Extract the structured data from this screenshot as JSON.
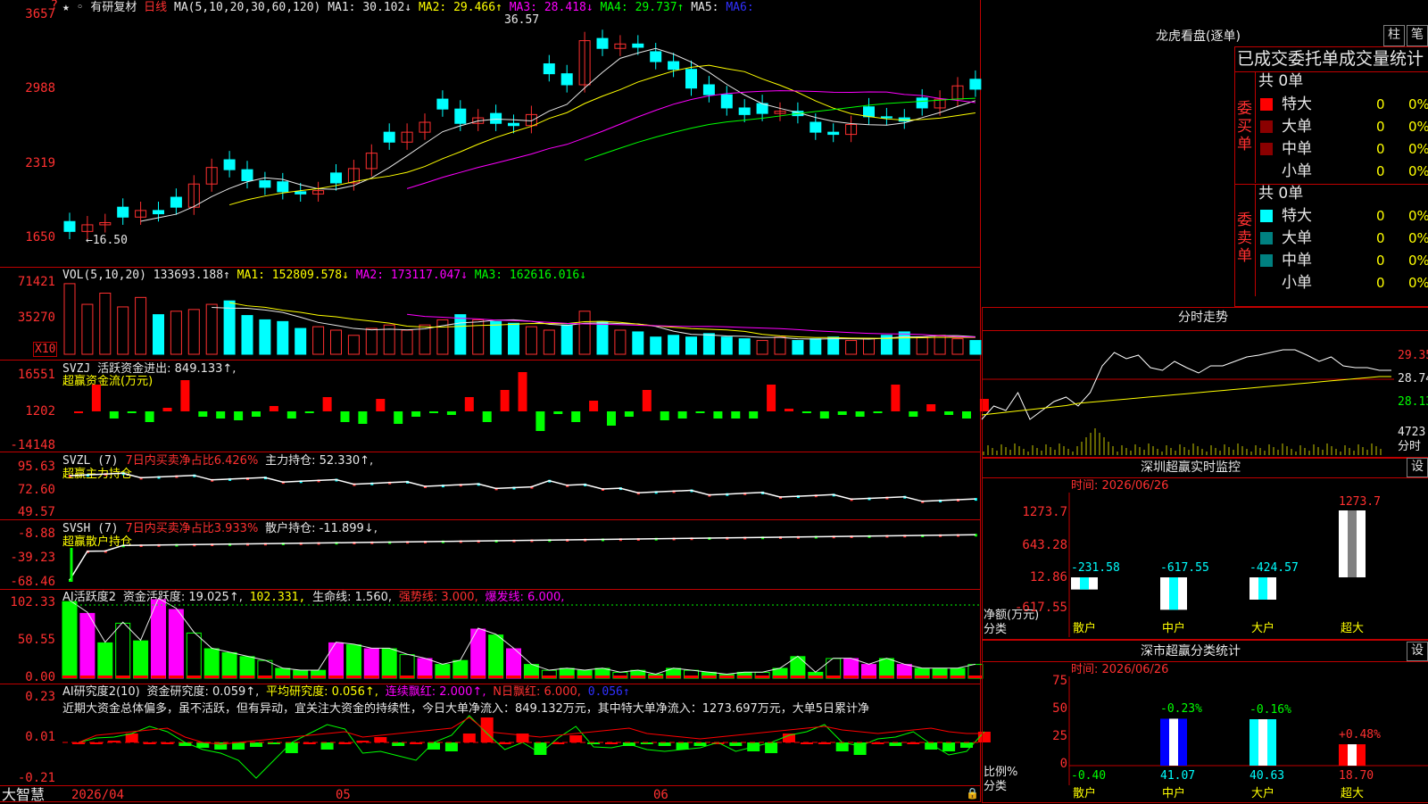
{
  "chart_header": {
    "title": "有研复材",
    "period": "日线",
    "ma_label": "MA(5,10,20,30,60,120)",
    "ma1": "MA1: 30.102↓",
    "ma2": "MA2: 29.466↑",
    "ma3": "MA3: 28.418↓",
    "ma4": "MA4: 29.737↑",
    "ma5": "MA5:",
    "ma6": "MA6:",
    "high_mark": "36.57",
    "low_mark": "←16.50"
  },
  "price_axis": [
    "3657",
    "2988",
    "2319",
    "1650"
  ],
  "vol_header": {
    "label": "VOL(5,10,20)",
    "value": "133693.188↑",
    "ma1": "MA1: 152809.578↓",
    "ma2": "MA2: 173117.047↓",
    "ma3": "MA3: 162616.016↓",
    "unit": "X10"
  },
  "vol_axis": [
    "71421",
    "35270"
  ],
  "svzj": {
    "label": "SVZJ",
    "title": "活跃资金进出: 849.133↑,",
    "sub": "超赢资金流(万元)",
    "axis": [
      "16551",
      "1202",
      "-14148"
    ]
  },
  "svzl": {
    "label": "SVZL (7)",
    "ratio": "7日内买卖净占比6.426%",
    "hold": "主力持仓: 52.330↑,",
    "sub": "超赢主力持仓",
    "axis": [
      "95.63",
      "72.60",
      "49.57"
    ]
  },
  "svsh": {
    "label": "SVSH (7)",
    "ratio": "7日内买卖净占比3.933%",
    "hold": "散户持仓: -11.899↓,",
    "sub": "超赢散户持仓",
    "axis": [
      "-8.88",
      "-39.23",
      "-68.46"
    ]
  },
  "ai1": {
    "label": "AI活跃度2",
    "v1": "资金活跃度: 19.025↑,",
    "v2": "102.331,",
    "v3": "生命线: 1.560,",
    "v4": "强势线: 3.000,",
    "v5": "爆发线: 6.000,",
    "axis": [
      "102.33",
      "50.55",
      "0.00"
    ]
  },
  "ai2": {
    "label": "AI研究度2(10)",
    "v1": "资金研究度: 0.059↑,",
    "v2": "平均研究度: 0.056↑,",
    "v3": "连续飘红: 2.000↑,",
    "v4": "N日飘红: 6.000,",
    "v5": "0.056↑",
    "comment": "近期大资金总体偏多，虽不活跃，但有异动，宜关注大资金的持续性，今日大单净流入：849.132万元，其中特大单净流入：1273.697万元，大单5日累计净",
    "axis": [
      "0.23",
      "0.01",
      "-0.21"
    ]
  },
  "x_axis": {
    "brand": "大智慧",
    "d1": "2026/04",
    "d2": "05",
    "d3": "06"
  },
  "lhb": {
    "title": "龙虎看盘(逐单)",
    "btn1": "柱",
    "btn2": "笔",
    "tabs": "已成交委托单成交量统计",
    "buy_total": "共 0单",
    "sell_total": "共 0单",
    "buy_label": "委买单",
    "sell_label": "委卖单",
    "buy_rows": [
      {
        "name": "特大",
        "n": "0",
        "p": "0%"
      },
      {
        "name": "大单",
        "n": "0",
        "p": "0%"
      },
      {
        "name": "中单",
        "n": "0",
        "p": "0%"
      },
      {
        "name": "小单",
        "n": "0",
        "p": "0%"
      }
    ],
    "sell_rows": [
      {
        "name": "特大",
        "n": "0",
        "p": "0%"
      },
      {
        "name": "大单",
        "n": "0",
        "p": "0%"
      },
      {
        "name": "中单",
        "n": "0",
        "p": "0%"
      },
      {
        "name": "小单",
        "n": "0",
        "p": "0%"
      }
    ]
  },
  "fenshi": {
    "title": "分时走势",
    "p1": "29.35",
    "p2": "28.74",
    "p3": "28.13",
    "vol": "4723",
    "unit": "分时"
  },
  "monitor": {
    "title": "深圳超赢实时监控",
    "btn": "设",
    "time": "时间: 2026/06/26",
    "axis": [
      "1273.7",
      "643.28",
      "12.86",
      "-617.55"
    ],
    "ylab": "净额(万元)",
    "xlab": "分类",
    "cats": [
      "散户",
      "中户",
      "大户",
      "超大"
    ],
    "vals": [
      "-231.58",
      "-617.55",
      "-424.57",
      "1273.7"
    ]
  },
  "classify": {
    "title": "深市超赢分类统计",
    "btn": "设",
    "time": "时间: 2026/06/26",
    "axis": [
      "75",
      "50",
      "25",
      "0"
    ],
    "ylab": "比例%",
    "xlab": "分类",
    "cats": [
      "散户",
      "中户",
      "大户",
      "超大"
    ],
    "pcts": [
      "-0.40",
      "41.07",
      "40.63",
      "18.70"
    ],
    "chg": [
      "-0.23%",
      "-0.16%",
      "+0.48%"
    ]
  },
  "colors": {
    "up": "#ff3030",
    "down": "#00ffff",
    "ma1": "#ffffff",
    "ma2": "#ffff00",
    "ma3": "#ff00ff",
    "ma4": "#00ff00",
    "grid": "#c00000"
  }
}
